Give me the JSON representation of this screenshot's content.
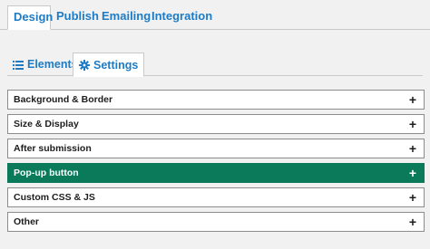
{
  "top_tabs": [
    {
      "label": "Design",
      "active": true
    },
    {
      "label": "Publish",
      "active": false
    },
    {
      "label": "Emailing",
      "active": false
    },
    {
      "label": "Integration",
      "active": false
    }
  ],
  "sub_tabs": [
    {
      "label": "Elements",
      "icon": "list-icon",
      "active": false
    },
    {
      "label": "Settings",
      "icon": "gear-icon",
      "active": true
    }
  ],
  "sections": [
    {
      "label": "Background & Border",
      "expand_symbol": "+",
      "active": false
    },
    {
      "label": "Size & Display",
      "expand_symbol": "+",
      "active": false
    },
    {
      "label": "After submission",
      "expand_symbol": "+",
      "active": false
    },
    {
      "label": "Pop-up button",
      "expand_symbol": "+",
      "active": true
    },
    {
      "label": "Custom CSS & JS",
      "expand_symbol": "+",
      "active": false
    },
    {
      "label": "Other",
      "expand_symbol": "+",
      "active": false
    }
  ],
  "colors": {
    "tab_text": "#1e7bc4",
    "active_section_bg": "#0a7a5a",
    "page_bg": "#f1f1f1"
  }
}
